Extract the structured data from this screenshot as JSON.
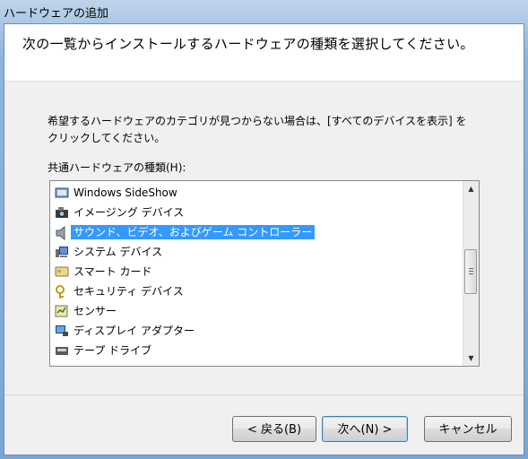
{
  "window": {
    "title": "ハードウェアの追加"
  },
  "header": {
    "text": "次の一覧からインストールするハードウェアの種類を選択してください。"
  },
  "description": {
    "line1": "希望するハードウェアのカテゴリが見つからない場合は、[すべてのデバイスを表示] を",
    "line2": "クリックしてください。"
  },
  "list": {
    "label": "共通ハードウェアの種類(H):",
    "items": [
      {
        "label": "Windows SideShow",
        "icon": "sideshow-icon"
      },
      {
        "label": "イメージング デバイス",
        "icon": "camera-icon"
      },
      {
        "label": "サウンド、ビデオ、およびゲーム コントローラー",
        "icon": "speaker-icon",
        "selected": true
      },
      {
        "label": "システム デバイス",
        "icon": "system-device-icon"
      },
      {
        "label": "スマート カード",
        "icon": "smart-card-icon"
      },
      {
        "label": "セキュリティ デバイス",
        "icon": "key-icon"
      },
      {
        "label": "センサー",
        "icon": "sensor-icon"
      },
      {
        "label": "ディスプレイ アダプター",
        "icon": "display-adapter-icon"
      },
      {
        "label": "テープ ドライブ",
        "icon": "tape-drive-icon"
      }
    ]
  },
  "buttons": {
    "back": "< 戻る(B)",
    "next": "次へ(N) >",
    "cancel": "キャンセル"
  }
}
